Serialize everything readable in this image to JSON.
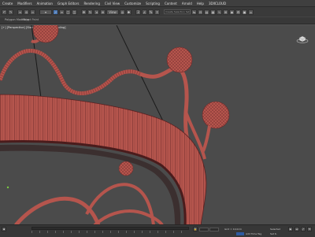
{
  "menu": [
    "Create",
    "Modifiers",
    "Animation",
    "Graph Editors",
    "Rendering",
    "Civil View",
    "Customize",
    "Scripting",
    "Content",
    "Arnold",
    "Help",
    "3DXCLOUD"
  ],
  "toolbar": {
    "named_selection_placeholder": "Create Selection Set",
    "view_dropdown": "View"
  },
  "ribbon": {
    "label": "Polygon Modeling",
    "sub_label": "Object Paint"
  },
  "viewport": {
    "label": "[+] [Perspective] [Standard] [Default Shading]"
  },
  "status": {
    "grid": "Grid = 10,0cm",
    "add_time_tag": "Add Time Tag",
    "selected": "Selected",
    "set_key": "Set K."
  },
  "colors": {
    "model": "#b5554d",
    "model_dark": "#7a3030",
    "viewport_bg": "#4b4b4b",
    "accent": "#4a78b5"
  }
}
